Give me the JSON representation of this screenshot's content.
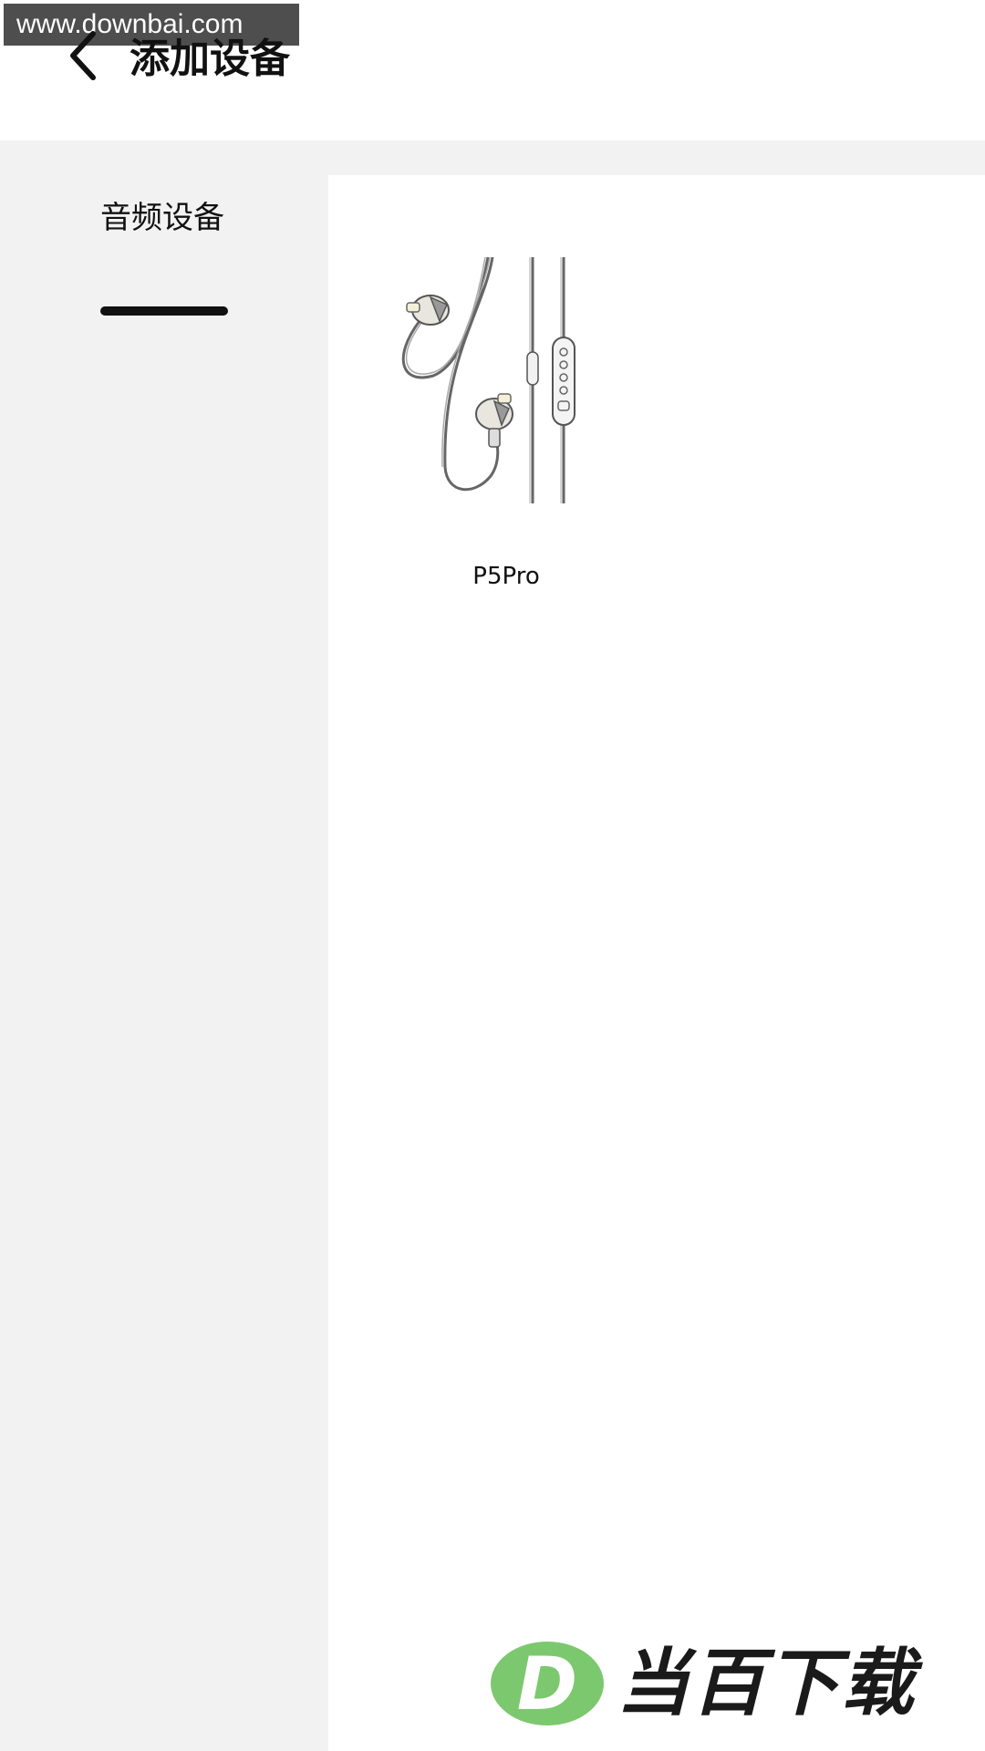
{
  "watermark": {
    "top_text": "www.downbai.com",
    "brand_text": "当百下载",
    "brand_letter": "D"
  },
  "header": {
    "back_icon": "chevron-left-icon",
    "title": "添加设备"
  },
  "sidebar": {
    "items": [
      {
        "label": "音频设备",
        "selected": true
      }
    ]
  },
  "devices": [
    {
      "name": "P5Pro",
      "image_icon": "earphones-illustration"
    }
  ],
  "colors": {
    "background_gray": "#f2f2f2",
    "panel_white": "#ffffff",
    "text_primary": "#111111",
    "brand_green": "#7cc86e"
  }
}
